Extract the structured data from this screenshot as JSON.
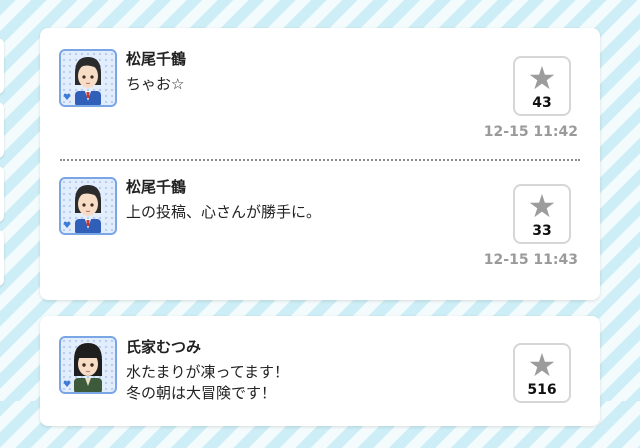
{
  "posts": [
    {
      "author": "松尾千鶴",
      "message": "ちゃお☆",
      "likes": "43",
      "time": "12-15 11:42",
      "avatar_icon": "chizuru-avatar-icon"
    },
    {
      "author": "松尾千鶴",
      "message": "上の投稿、心さんが勝手に。",
      "likes": "33",
      "time": "12-15 11:43",
      "avatar_icon": "chizuru-avatar-icon"
    },
    {
      "author": "氏家むつみ",
      "message": "水たまりが凍ってます！\n冬の朝は大冒険です！",
      "likes": "516",
      "time": "",
      "avatar_icon": "mutsumi-avatar-icon"
    }
  ],
  "icons": {
    "like": "star-icon",
    "badge": "heart-icon"
  },
  "colors": {
    "background_stripe": "#cdeef6",
    "avatar_border": "#7aa6e6",
    "star": "#9c9c9c",
    "timestamp": "#9a9a9a"
  }
}
